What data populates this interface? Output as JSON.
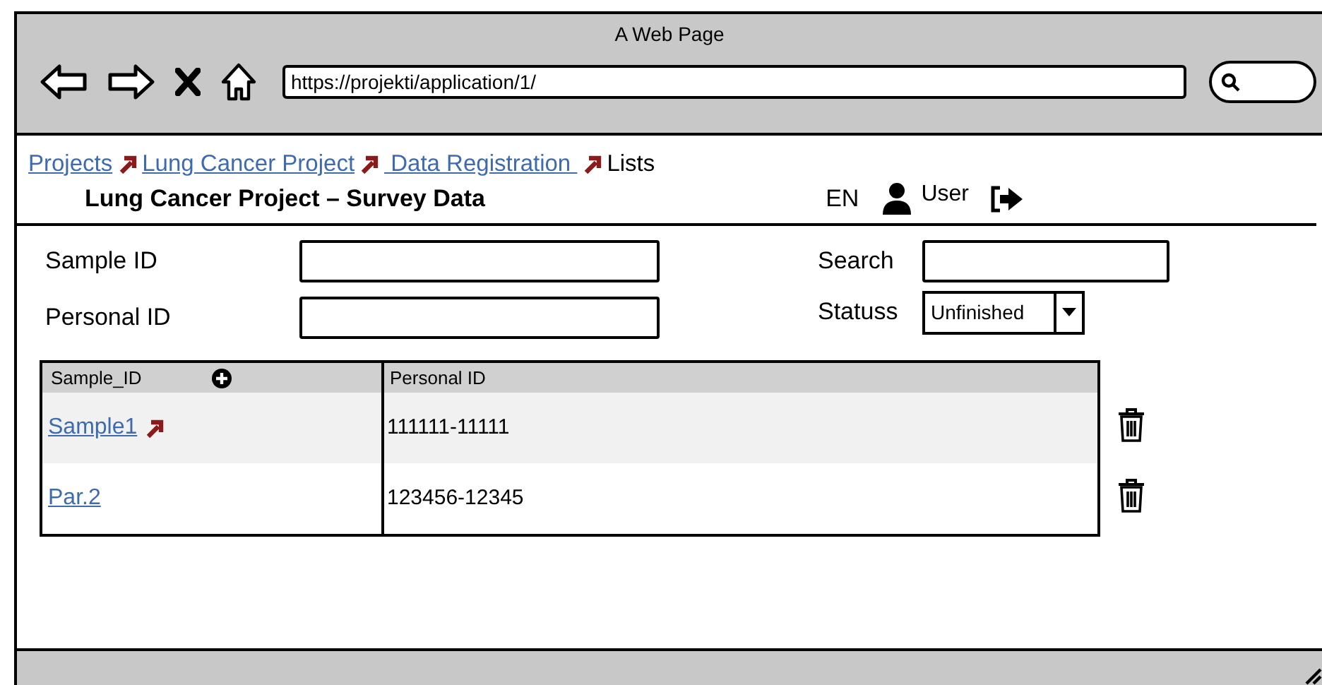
{
  "window": {
    "title": "A Web Page"
  },
  "address_bar": {
    "value": "https://projekti/application/1/"
  },
  "breadcrumb": [
    {
      "label": "Projects",
      "kind": "link"
    },
    {
      "label": "Lung Cancer Project",
      "kind": "link"
    },
    {
      "label": " Data Registration ",
      "kind": "link"
    },
    {
      "label": "Lists",
      "kind": "current"
    }
  ],
  "page_title": "Lung Cancer Project – Survey Data",
  "header": {
    "language": "EN",
    "user": "User"
  },
  "filters": {
    "sample_id": {
      "label": "Sample ID"
    },
    "personal_id": {
      "label": "Personal ID"
    },
    "search": {
      "label": "Search"
    },
    "status": {
      "label": "Statuss",
      "value": "Unfinished"
    }
  },
  "table": {
    "columns": [
      "Sample_ID",
      "Personal ID"
    ],
    "rows": [
      {
        "sample_id": "Sample1",
        "personal_id": "111111-11111",
        "arrow": true
      },
      {
        "sample_id": "Par.2",
        "personal_id": "123456-12345",
        "arrow": false
      }
    ]
  }
}
